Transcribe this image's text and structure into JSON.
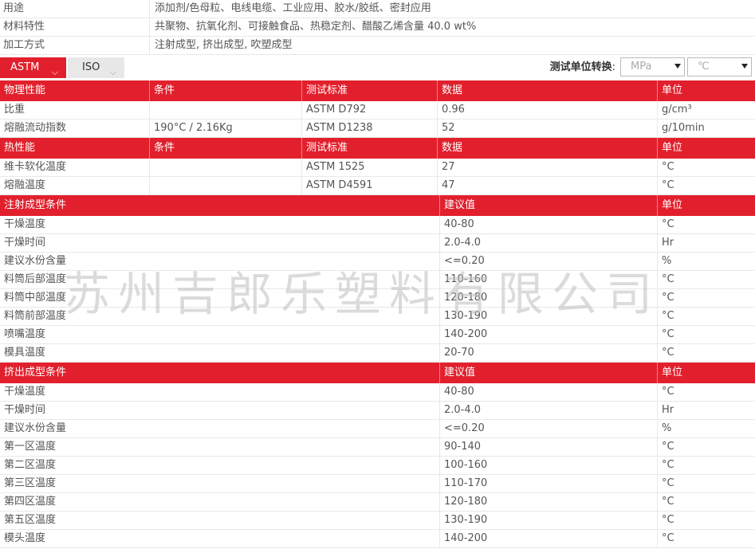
{
  "info": [
    {
      "key": "用途",
      "value": "添加剂/色母粒、电线电缆、工业应用、胶水/胶纸、密封应用"
    },
    {
      "key": "材料特性",
      "value": "共聚物、抗氧化剂、可接触食品、热稳定剂、醋酸乙烯含量 40.0 wt%"
    },
    {
      "key": "加工方式",
      "value": "注射成型, 挤出成型, 吹塑成型"
    }
  ],
  "toolbar": {
    "tab_astm": "ASTM",
    "tab_iso": "ISO",
    "unit_label": "测试单位转换",
    "unit_colon": ":",
    "unit_pressure": "MPa",
    "unit_temp": "℃"
  },
  "physical": {
    "headers": [
      "物理性能",
      "条件",
      "测试标准",
      "数据",
      "单位"
    ],
    "rows": [
      [
        "比重",
        "",
        "ASTM D792",
        "0.96",
        "g/cm³"
      ],
      [
        "熔融流动指数",
        "190°C / 2.16Kg",
        "ASTM D1238",
        "52",
        "g/10min"
      ]
    ]
  },
  "thermal": {
    "headers": [
      "热性能",
      "条件",
      "测试标准",
      "数据",
      "单位"
    ],
    "rows": [
      [
        "维卡软化温度",
        "",
        "ASTM 1525",
        "27",
        "°C"
      ],
      [
        "熔融温度",
        "",
        "ASTM D4591",
        "47",
        "°C"
      ]
    ]
  },
  "injection": {
    "headers": [
      "注射成型条件",
      "建议值",
      "单位"
    ],
    "rows": [
      [
        "干燥温度",
        "40-80",
        "°C"
      ],
      [
        "干燥时间",
        "2.0-4.0",
        "Hr"
      ],
      [
        "建议水份含量",
        "<=0.20",
        "%"
      ],
      [
        "料筒后部温度",
        "110-160",
        "°C"
      ],
      [
        "料筒中部温度",
        "120-180",
        "°C"
      ],
      [
        "料筒前部温度",
        "130-190",
        "°C"
      ],
      [
        "喷嘴温度",
        "140-200",
        "°C"
      ],
      [
        "模具温度",
        "20-70",
        "°C"
      ]
    ]
  },
  "extrusion": {
    "headers": [
      "挤出成型条件",
      "建议值",
      "单位"
    ],
    "rows": [
      [
        "干燥温度",
        "40-80",
        "°C"
      ],
      [
        "干燥时间",
        "2.0-4.0",
        "Hr"
      ],
      [
        "建议水份含量",
        "<=0.20",
        "%"
      ],
      [
        "第一区温度",
        "90-140",
        "°C"
      ],
      [
        "第二区温度",
        "100-160",
        "°C"
      ],
      [
        "第三区温度",
        "110-170",
        "°C"
      ],
      [
        "第四区温度",
        "120-180",
        "°C"
      ],
      [
        "第五区温度",
        "130-190",
        "°C"
      ],
      [
        "模头温度",
        "140-200",
        "°C"
      ]
    ]
  },
  "watermark": "苏州吉郎乐塑料有限公司"
}
